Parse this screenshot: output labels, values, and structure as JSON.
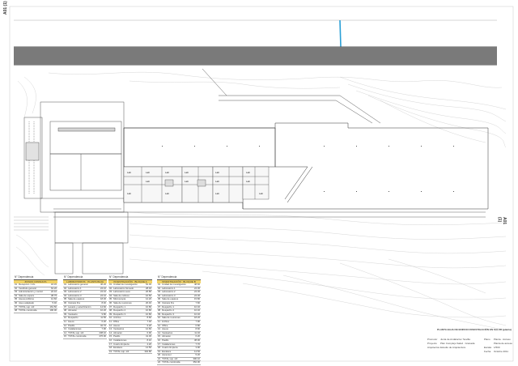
{
  "sheet_code": "A01 (1)",
  "sheet_code_right": "A01 (1)",
  "title_block": {
    "title": "PLANTA BAJA DE EDIFICIO INVESTIGACIÓN EN SALUD (planta)",
    "lines": [
      [
        "Promotor",
        "Junta de Andalucía / Sevilla",
        "Plano",
        "Planta · Acceso"
      ],
      [
        "Proyecto",
        "Plan Complejo Salud · Granada",
        "",
        "Planta de acceso"
      ],
      [
        "Arquitectos",
        "Estudio de Arquitectura",
        "Escala",
        "1/500"
      ],
      [
        "",
        "",
        "Fecha",
        "Octubre 2011"
      ]
    ]
  },
  "legends": [
    {
      "header": "N°   Dependencia",
      "band": "ZONAS CONSULTA",
      "rows": [
        [
          "01",
          "Recepción / Info",
          "18.45"
        ],
        [
          "02",
          "Vestíbulo general",
          "64.20"
        ],
        [
          "03",
          "Administración y control",
          "22.10"
        ],
        [
          "04",
          "Sala de espera",
          "38.75"
        ],
        [
          "05",
          "Aseos públicos",
          "12.60"
        ],
        [
          "06",
          "Aseo adaptado",
          "5.40"
        ],
        [
          "07",
          "TOTAL sup. útil",
          "161.50"
        ],
        [
          "08",
          "TOTAL construida",
          "190.00"
        ]
      ]
    },
    {
      "header": "N°   Dependencia",
      "band": "LABORATORIOS · PLANTA BAJA",
      "rows": [
        [
          "01",
          "Laboratorio general",
          "46.20"
        ],
        [
          "02",
          "Laboratorio 1",
          "24.10"
        ],
        [
          "03",
          "Laboratorio 2",
          "24.10"
        ],
        [
          "04",
          "Laboratorio 3",
          "24.10"
        ],
        [
          "05",
          "Sala de equipos",
          "18.30"
        ],
        [
          "06",
          "Cámara fría",
          "8.40"
        ],
        [
          "07",
          "Lavado y esterilización",
          "14.60"
        ],
        [
          "08",
          "Almacén",
          "10.20"
        ],
        [
          "09",
          "Vestuario",
          "9.80"
        ],
        [
          "10",
          "Despacho",
          "11.50"
        ],
        [
          "11",
          "Aseos",
          "6.20"
        ],
        [
          "12",
          "Pasillo",
          "32.70"
        ],
        [
          "13",
          "Instalaciones",
          "7.90"
        ],
        [
          "14",
          "TOTAL sup. útil",
          "238.10"
        ],
        [
          "15",
          "TOTAL construida",
          "276.00"
        ]
      ]
    },
    {
      "header": "N°   Dependencia",
      "band": "INVESTIGACIÓN · BLOQUE A",
      "rows": [
        [
          "01",
          "Unidad de investigación",
          "52.30"
        ],
        [
          "02",
          "Laboratorio húmedo",
          "28.40"
        ],
        [
          "03",
          "Laboratorio seco",
          "26.80"
        ],
        [
          "04",
          "Sala de cultivos",
          "16.50"
        ],
        [
          "05",
          "Microscopía",
          "12.20"
        ],
        [
          "06",
          "Sala de reuniones",
          "20.40"
        ],
        [
          "07",
          "Despacho 1",
          "10.80"
        ],
        [
          "08",
          "Despacho 2",
          "10.80"
        ],
        [
          "09",
          "Despacho 3",
          "10.80"
        ],
        [
          "10",
          "Archivo",
          "8.60"
        ],
        [
          "11",
          "Office",
          "7.40"
        ],
        [
          "12",
          "Aseos",
          "9.20"
        ],
        [
          "13",
          "Vestuarios",
          "12.60"
        ],
        [
          "14",
          "Almacén",
          "6.90"
        ],
        [
          "15",
          "Pasillo",
          "41.30"
        ],
        [
          "16",
          "Instalaciones",
          "8.10"
        ],
        [
          "17",
          "Cuarto limpieza",
          "4.20"
        ],
        [
          "18",
          "Escalera",
          "14.50"
        ],
        [
          "19",
          "TOTAL sup. útil",
          "302.80"
        ]
      ]
    },
    {
      "header": "N°   Dependencia",
      "band": "INVESTIGACIÓN · BLOQUE B",
      "rows": [
        [
          "01",
          "Unidad de investigación",
          "48.60"
        ],
        [
          "02",
          "Laboratorio 1",
          "24.30"
        ],
        [
          "03",
          "Laboratorio 2",
          "24.30"
        ],
        [
          "04",
          "Laboratorio 3",
          "24.30"
        ],
        [
          "05",
          "Sala de equipos",
          "15.80"
        ],
        [
          "06",
          "Cámara fría",
          "7.60"
        ],
        [
          "07",
          "Despacho 1",
          "10.40"
        ],
        [
          "08",
          "Despacho 2",
          "10.40"
        ],
        [
          "09",
          "Despacho 3",
          "10.40"
        ],
        [
          "10",
          "Sala de reuniones",
          "18.20"
        ],
        [
          "11",
          "Archivo",
          "7.90"
        ],
        [
          "12",
          "Office",
          "6.80"
        ],
        [
          "13",
          "Aseos",
          "8.60"
        ],
        [
          "14",
          "Vestuarios",
          "11.40"
        ],
        [
          "15",
          "Almacén",
          "6.20"
        ],
        [
          "16",
          "Pasillo",
          "38.90"
        ],
        [
          "17",
          "Instalaciones",
          "7.70"
        ],
        [
          "18",
          "Cuarto limpieza",
          "3.90"
        ],
        [
          "19",
          "Escalera",
          "14.50"
        ],
        [
          "20",
          "Ascensor",
          "5.20"
        ],
        [
          "21",
          "TOTAL sup. útil",
          "300.10"
        ],
        [
          "22",
          "TOTAL construida",
          "352.00"
        ]
      ]
    }
  ],
  "room_labels": [
    "Lab",
    "Lab",
    "Lab",
    "Lab",
    "Lab",
    "Lab",
    "Lab",
    "Lab",
    "Lab",
    "Lab",
    "Lab",
    "Lab",
    "Lab",
    "Lab"
  ],
  "colors": {
    "road": "#7a7a7a",
    "water": "#2a9fd6",
    "line": "#333333",
    "contour": "#b5b5b5",
    "legend_band": "#f1d36a"
  }
}
